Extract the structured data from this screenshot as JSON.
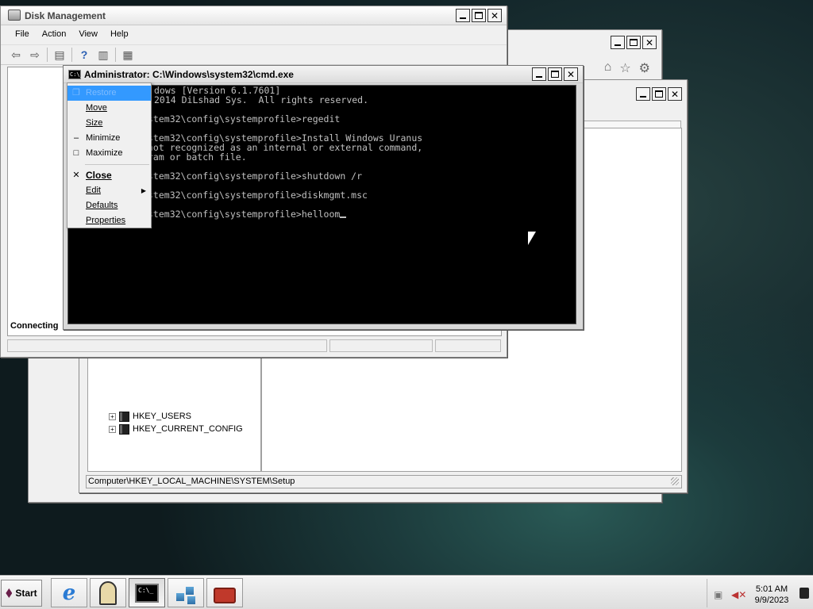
{
  "windows": {
    "disk_management": {
      "title": "Disk Management",
      "menu": [
        "File",
        "Action",
        "View",
        "Help"
      ],
      "status_text": "Connecting"
    },
    "cmd": {
      "title": "Administrator: C:\\Windows\\system32\\cmd.exe",
      "icon_text": "C:\\_",
      "lines": [
        "dows [Version 6.1.7601]",
        "2014 DiLshad Sys.  All rights reserved.",
        "",
        "stem32\\config\\systemprofile>regedit",
        "",
        "stem32\\config\\systemprofile>Install Windows Uranus",
        "not recognized as an internal or external command,",
        "ram or batch file.",
        "",
        "stem32\\config\\systemprofile>shutdown /r",
        "",
        "stem32\\config\\systemprofile>diskmgmt.msc",
        "",
        "stem32\\config\\systemprofile>helloom"
      ]
    },
    "system_menu": {
      "items": [
        {
          "label": "Restore",
          "glyph": "❐",
          "disabled": true
        },
        {
          "label": "Move",
          "glyph": ""
        },
        {
          "label": "Size",
          "glyph": ""
        },
        {
          "label": "Minimize",
          "glyph": "–"
        },
        {
          "label": "Maximize",
          "glyph": "□"
        },
        {
          "label": "Close",
          "glyph": "✕"
        },
        {
          "label": "Edit",
          "glyph": "",
          "submenu": "▶"
        },
        {
          "label": "Defaults",
          "glyph": ""
        },
        {
          "label": "Properties",
          "glyph": ""
        }
      ]
    },
    "regedit": {
      "tree": [
        "HKEY_USERS",
        "HKEY_CURRENT_CONFIG"
      ],
      "status_path": "Computer\\HKEY_LOCAL_MACHINE\\SYSTEM\\Setup"
    }
  },
  "taskbar": {
    "start_label": "Start",
    "clock_time": "5:01 AM",
    "clock_date": "9/9/2023"
  }
}
